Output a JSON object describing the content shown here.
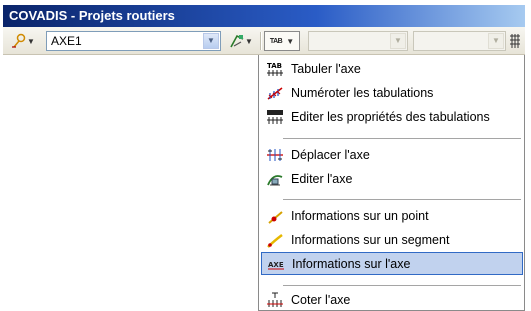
{
  "window": {
    "title": "COVADIS - Projets routiers"
  },
  "toolbar": {
    "axis_combo_value": "AXE1",
    "tab_button_text": "TAB",
    "disabled_combo_1_value": "",
    "disabled_combo_2_value": ""
  },
  "menu": {
    "items": [
      {
        "label": "Tabuler l'axe",
        "icon": "tab-icon"
      },
      {
        "label": "Numéroter les tabulations",
        "icon": "number-tabs-icon"
      },
      {
        "label": "Editer les propriétés des tabulations",
        "icon": "tab-properties-icon"
      },
      {
        "label": "Déplacer l'axe",
        "icon": "move-axis-icon"
      },
      {
        "label": "Editer l'axe",
        "icon": "edit-axis-icon"
      },
      {
        "label": "Informations sur un point",
        "icon": "point-info-icon"
      },
      {
        "label": "Informations sur un segment",
        "icon": "segment-info-icon"
      },
      {
        "label": "Informations sur l'axe",
        "icon": "axis-info-icon",
        "highlighted": true
      },
      {
        "label": "Coter l'axe",
        "icon": "dimension-axis-icon"
      }
    ]
  },
  "colors": {
    "title_start": "#0a246a",
    "title_end": "#a6caf0",
    "highlight": "#c1d2ee",
    "highlight_border": "#316ac5"
  }
}
